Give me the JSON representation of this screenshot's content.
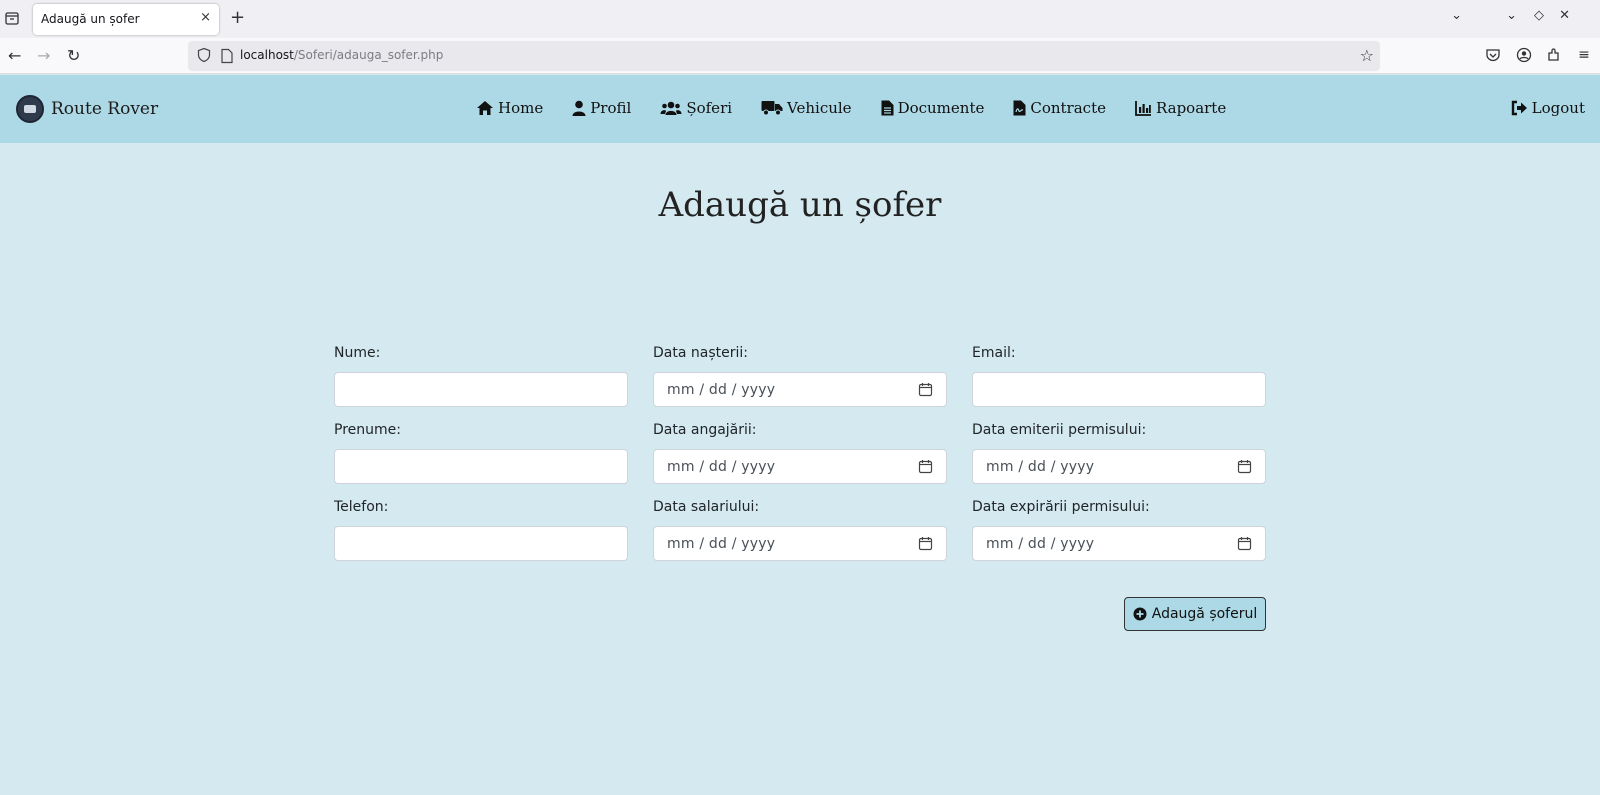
{
  "browser": {
    "tab_title": "Adaugă un șofer",
    "tab_close": "×",
    "new_tab": "+",
    "url_host": "localhost",
    "url_path": "/Soferi/adauga_sofer.php"
  },
  "site": {
    "brand": "Route Rover",
    "menu": [
      {
        "label": "Home",
        "icon": "home-icon"
      },
      {
        "label": "Profil",
        "icon": "user-icon"
      },
      {
        "label": "Șoferi",
        "icon": "users-icon"
      },
      {
        "label": "Vehicule",
        "icon": "truck-icon"
      },
      {
        "label": "Documente",
        "icon": "file-icon"
      },
      {
        "label": "Contracte",
        "icon": "contract-icon"
      },
      {
        "label": "Rapoarte",
        "icon": "chart-icon"
      }
    ],
    "logout": "Logout"
  },
  "page": {
    "title": "Adaugă un șofer"
  },
  "form": {
    "fields": [
      {
        "label": "Nume:",
        "type": "text",
        "value": ""
      },
      {
        "label": "Data nașterii:",
        "type": "date",
        "placeholder": "mm / dd / yyyy"
      },
      {
        "label": "Email:",
        "type": "text",
        "value": ""
      },
      {
        "label": "Prenume:",
        "type": "text",
        "value": ""
      },
      {
        "label": "Data angajării:",
        "type": "date",
        "placeholder": "mm / dd / yyyy"
      },
      {
        "label": "Data emiterii permisului:",
        "type": "date",
        "placeholder": "mm / dd / yyyy"
      },
      {
        "label": "Telefon:",
        "type": "text",
        "value": ""
      },
      {
        "label": "Data salariului:",
        "type": "date",
        "placeholder": "mm / dd / yyyy"
      },
      {
        "label": "Data expirării permisului:",
        "type": "date",
        "placeholder": "mm / dd / yyyy"
      }
    ],
    "submit_label": "Adaugă șoferul"
  },
  "colors": {
    "nav_bg": "#add8e6",
    "page_bg": "#d4e9f0"
  }
}
